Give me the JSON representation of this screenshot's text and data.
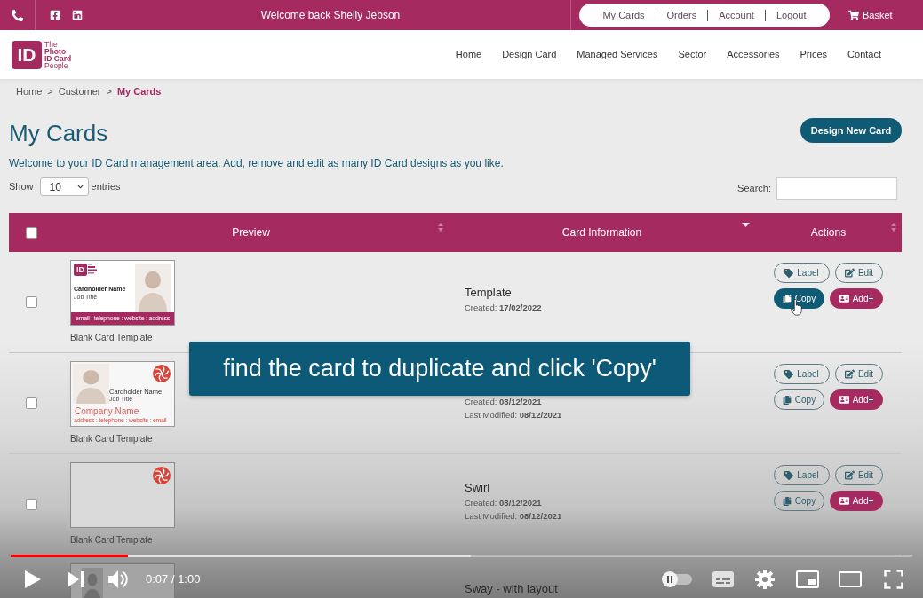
{
  "top_bar": {
    "welcome": "Welcome back Shelly Jebson",
    "account_links": [
      {
        "label": "My Cards"
      },
      {
        "label": "Orders"
      },
      {
        "label": "Account"
      },
      {
        "label": "Logout"
      }
    ],
    "basket": "Basket"
  },
  "header": {
    "logo": {
      "mark": "ID",
      "wordmark": [
        "The",
        "**Photo**",
        "**ID Card**",
        "People"
      ]
    },
    "nav": [
      "Home",
      "Design Card",
      "Managed Services",
      "Sector",
      "Accessories",
      "Prices",
      "Contact"
    ]
  },
  "breadcrumb": [
    {
      "label": "Home",
      "current": false,
      "separator": ">"
    },
    {
      "label": "Customer",
      "current": false,
      "separator": ">"
    },
    {
      "label": "My Cards",
      "current": true
    }
  ],
  "page": {
    "title": "My Cards",
    "design_button": "Design New Card",
    "intro": "Welcome to your ID Card management area. Add, remove and edit as many ID Card designs as you like.",
    "length_menu": {
      "prefix": "Show",
      "value": "10",
      "suffix": "entries"
    },
    "search": {
      "label": "Search:"
    }
  },
  "table": {
    "select_all": {
      "checked": false
    },
    "columns": [
      {
        "label": "Preview",
        "sorted": false
      },
      {
        "label": "Card Information",
        "sorted": true
      },
      {
        "label": "Actions",
        "sorted": false
      }
    ],
    "rows": [
      {
        "checked": false,
        "preview": {
          "kind": "logo_photo",
          "logo": "ID",
          "name": "Cardholder Name",
          "job": "Job Title",
          "footer": "email : telephone : website : address"
        },
        "caption": "Blank Card Template",
        "title": "Template",
        "created": "Created: **17/02/2022**",
        "actions": [
          {
            "kind": "label",
            "label": "Label",
            "hovered": false
          },
          {
            "kind": "edit",
            "label": "Edit",
            "hovered": false
          },
          {
            "kind": "copy",
            "label": "Copy",
            "hovered": true
          },
          {
            "kind": "add",
            "label": "Add+",
            "hovered": false
          }
        ]
      },
      {
        "checked": false,
        "preview": {
          "kind": "company",
          "name": "Cardholder Name",
          "job": "Job Title",
          "company": "Company Name",
          "footer": "address : telephone : website : email"
        },
        "caption": "Blank Card Template",
        "created": "Created: **08/12/2021**",
        "modified": "Last Modified: **08/12/2021**",
        "actions": [
          {
            "kind": "label",
            "label": "Label",
            "hovered": false
          },
          {
            "kind": "edit",
            "label": "Edit",
            "hovered": false
          },
          {
            "kind": "copy",
            "label": "Copy",
            "hovered": false
          },
          {
            "kind": "add",
            "label": "Add+",
            "hovered": false
          }
        ]
      },
      {
        "checked": false,
        "preview": {
          "kind": "blank"
        },
        "caption": "Blank Card Template",
        "title": "Swirl",
        "created": "Created: **08/12/2021**",
        "modified": "Last Modified: **08/12/2021**",
        "actions": [
          {
            "kind": "label",
            "label": "Label",
            "hovered": false
          },
          {
            "kind": "edit",
            "label": "Edit",
            "hovered": false
          },
          {
            "kind": "copy",
            "label": "Copy",
            "hovered": false
          },
          {
            "kind": "add",
            "label": "Add+",
            "hovered": false
          }
        ]
      },
      {
        "preview": {
          "kind": "partial"
        },
        "title": "Sway - with layout"
      }
    ]
  },
  "caption_overlay": {
    "text": "find the card to duplicate and click 'Copy'"
  },
  "player": {
    "progress": {
      "level": 0.13,
      "buffered": {
        "level": 0.51
      }
    },
    "time": "0:07 / 1:00",
    "autoplay": {
      "on": false
    }
  }
}
